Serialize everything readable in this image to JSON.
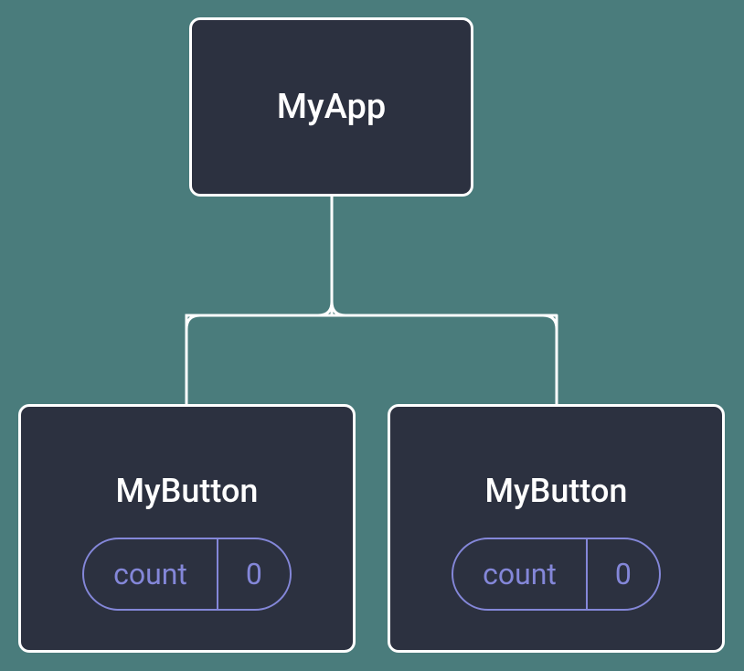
{
  "root": {
    "label": "MyApp"
  },
  "children": {
    "left": {
      "label": "MyButton",
      "state": {
        "key": "count",
        "value": "0"
      }
    },
    "right": {
      "label": "MyButton",
      "state": {
        "key": "count",
        "value": "0"
      }
    }
  },
  "colors": {
    "background": "#4a7c7c",
    "node_fill": "#2c3140",
    "node_border": "#ffffff",
    "state_accent": "#8487d9"
  }
}
